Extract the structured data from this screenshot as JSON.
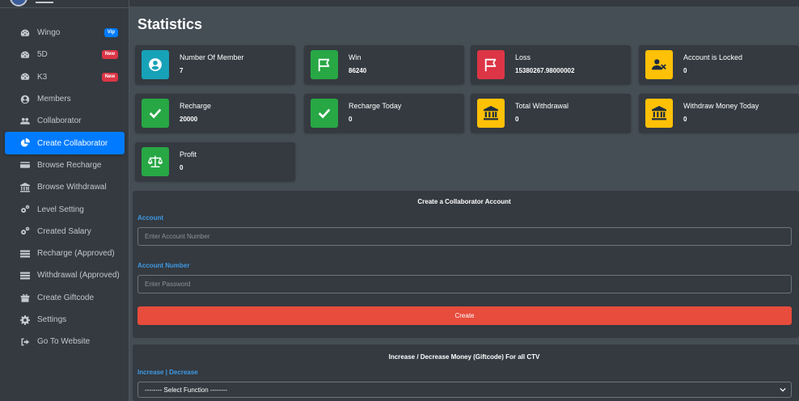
{
  "sidebar": {
    "items": [
      {
        "label": "Wingo",
        "icon": "tachometer-icon",
        "badge": "Vip",
        "badge_color": "#007bff"
      },
      {
        "label": "5D",
        "icon": "tachometer-icon",
        "badge": "New",
        "badge_color": "#dc3545"
      },
      {
        "label": "K3",
        "icon": "tachometer-icon",
        "badge": "New",
        "badge_color": "#dc3545"
      },
      {
        "label": "Members",
        "icon": "user-circle-icon"
      },
      {
        "label": "Collaborator",
        "icon": "users-icon"
      },
      {
        "label": "Create Collaborator",
        "icon": "pie-chart-icon",
        "active": true
      },
      {
        "label": "Browse Recharge",
        "icon": "credit-card-icon"
      },
      {
        "label": "Browse Withdrawal",
        "icon": "bank-icon"
      },
      {
        "label": "Level Setting",
        "icon": "cogs-icon"
      },
      {
        "label": "Created Salary",
        "icon": "cogs-icon"
      },
      {
        "label": "Recharge (Approved)",
        "icon": "list-icon"
      },
      {
        "label": "Withdrawal (Approved)",
        "icon": "list-icon"
      },
      {
        "label": "Create Giftcode",
        "icon": "gift-icon"
      },
      {
        "label": "Settings",
        "icon": "gear-icon"
      },
      {
        "label": "Go To Website",
        "icon": "sign-out-icon"
      }
    ]
  },
  "page": {
    "title": "Statistics"
  },
  "stats": [
    {
      "label": "Number Of Member",
      "value": "7",
      "color": "#17a2b8",
      "icon": "user-circle-icon"
    },
    {
      "label": "Win",
      "value": "86240",
      "color": "#28a745",
      "icon": "flag-icon"
    },
    {
      "label": "Loss",
      "value": "15380267.98000002",
      "color": "#dc3545",
      "icon": "flag-icon"
    },
    {
      "label": "Account is Locked",
      "value": "0",
      "color": "#ffc107",
      "icon": "user-times-icon"
    },
    {
      "label": "Recharge",
      "value": "20000",
      "color": "#28a745",
      "icon": "check-icon"
    },
    {
      "label": "Recharge Today",
      "value": "0",
      "color": "#28a745",
      "icon": "check-icon"
    },
    {
      "label": "Total Withdrawal",
      "value": "0",
      "color": "#ffc107",
      "icon": "bank-icon"
    },
    {
      "label": "Withdraw Money Today",
      "value": "0",
      "color": "#ffc107",
      "icon": "bank-icon"
    },
    {
      "label": "Profit",
      "value": "0",
      "color": "#28a745",
      "icon": "balance-scale-icon"
    }
  ],
  "create_form": {
    "title": "Create a Collaborator Account",
    "account_label": "Account",
    "account_placeholder": "Enter Account Number",
    "password_label": "Account Number",
    "password_placeholder": "Enter Password",
    "button_label": "Create"
  },
  "giftcode_form": {
    "title": "Increase / Decrease Money (Giftcode) For all CTV",
    "label": "Increase | Decrease",
    "select_value": "-------- Select Function --------"
  }
}
